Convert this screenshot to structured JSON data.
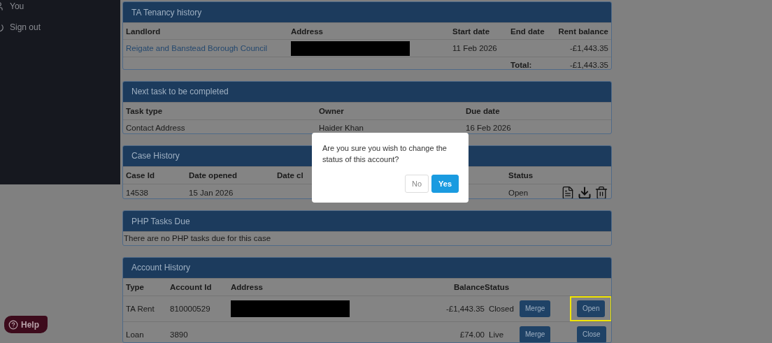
{
  "sidebar": {
    "items": [
      {
        "label": "You"
      },
      {
        "label": "Sign out"
      }
    ]
  },
  "tenancy_history": {
    "title": "TA Tenancy history",
    "columns": [
      "Landlord",
      "Address",
      "Start date",
      "End date",
      "Rent balance"
    ],
    "rows": [
      {
        "landlord": "Reigate and Banstead Borough Council",
        "address_redacted": true,
        "start_date": "11 Feb 2026",
        "rent_balance": "-£1,443.35"
      }
    ],
    "total_label": "Total:",
    "total": "-£1,443.35"
  },
  "next_task": {
    "title": "Next task to be completed",
    "columns": [
      "Task type",
      "Owner",
      "Due date"
    ],
    "rows": [
      {
        "task_type": "Contact Address",
        "owner": "Haider Khan",
        "due_date": "16 Feb 2026"
      }
    ]
  },
  "case_history": {
    "title": "Case History",
    "columns": [
      "Case Id",
      "Date opened",
      "Date cl",
      "Status"
    ],
    "rows": [
      {
        "case_id": "14538",
        "date_opened": "15 Jan 2026",
        "status": "Open"
      }
    ]
  },
  "php_tasks": {
    "title": "PHP Tasks Due",
    "message": "There are no PHP tasks due for this case"
  },
  "account_history": {
    "title": "Account History",
    "columns": [
      "Type",
      "Account Id",
      "Address",
      "Balance",
      "Status"
    ],
    "rows": [
      {
        "type": "TA Rent",
        "account_id": "810000529",
        "address_redacted": true,
        "balance": "-£1,443.35",
        "status": "Closed",
        "merge_label": "Merge",
        "toggle_label": "Open",
        "highlighted": true
      },
      {
        "type": "Loan",
        "account_id": "3890",
        "address_redacted": false,
        "balance": "£74.00",
        "status": "Live",
        "merge_label": "Merge",
        "toggle_label": "Close",
        "highlighted": false
      }
    ]
  },
  "dialog": {
    "message": "Are you sure you wish to change the status of this account?",
    "buttons": [
      {
        "label": "No",
        "kind": "secondary"
      },
      {
        "label": "Yes",
        "kind": "primary"
      }
    ]
  },
  "help_button": {
    "label": "Help"
  }
}
